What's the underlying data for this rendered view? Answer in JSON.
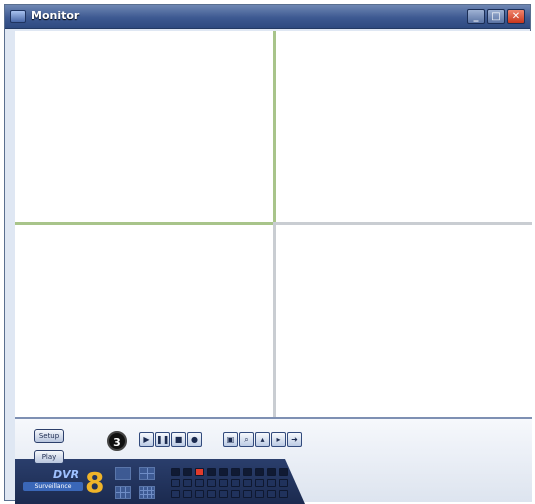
{
  "window": {
    "title": "Monitor"
  },
  "controls": {
    "setup_label": "Setup",
    "play_label": "Play",
    "view_count": "3",
    "logo_text": "DVR",
    "logo_number": "8",
    "logo_bar": "Surveillance"
  },
  "channels": {
    "selected_index": 2,
    "count": 10
  },
  "colors": {
    "accent": "#3d5991",
    "close": "#c7361c",
    "selected_channel": "#e23b2b",
    "active_grid": "#a8c48a"
  }
}
